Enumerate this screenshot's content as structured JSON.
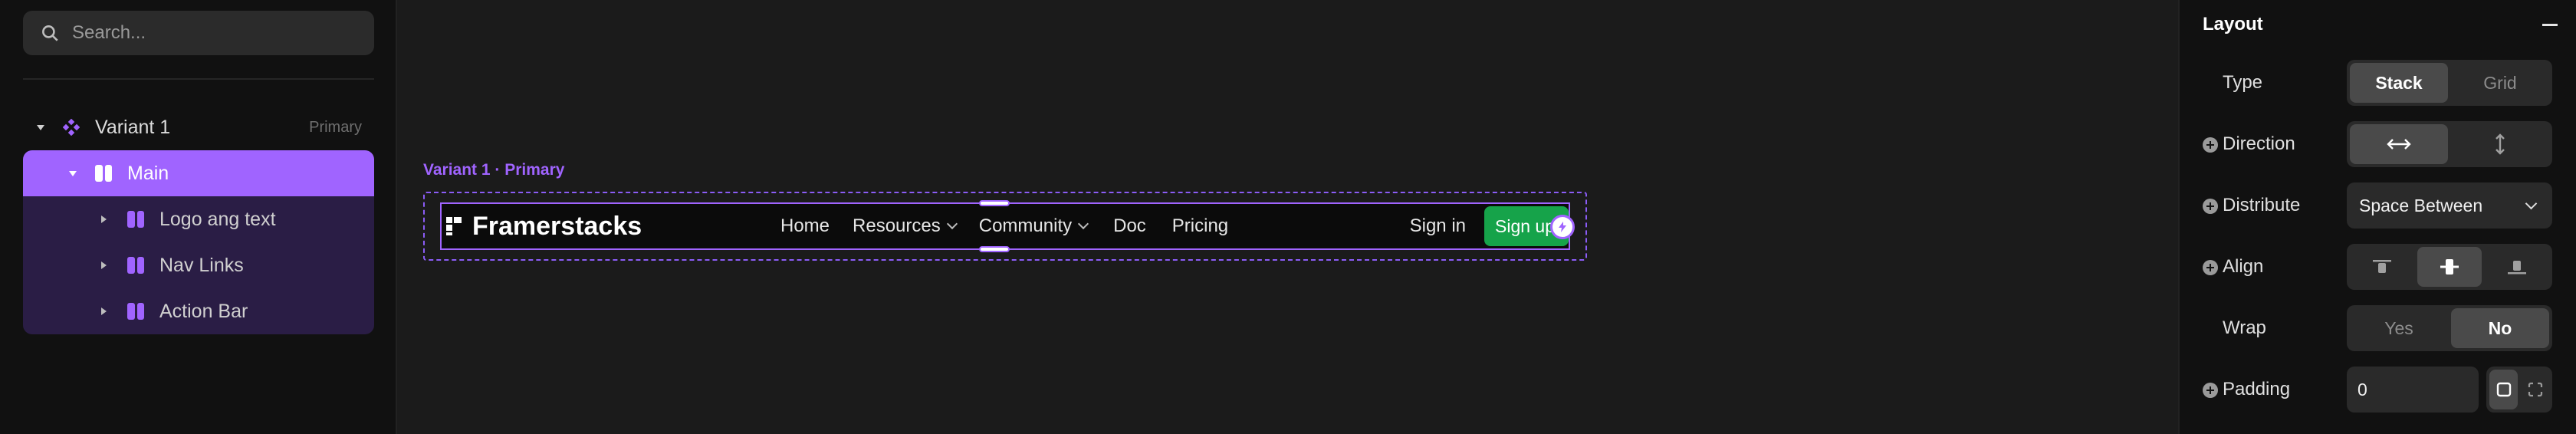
{
  "layers": {
    "search_placeholder": "Search...",
    "variant": {
      "label": "Variant 1",
      "tag": "Primary"
    },
    "main": {
      "label": "Main"
    },
    "children": [
      {
        "label": "Logo ang text"
      },
      {
        "label": "Nav Links"
      },
      {
        "label": "Action Bar"
      }
    ]
  },
  "canvas": {
    "frame_label": "Variant 1 · Primary",
    "navbar": {
      "brand": "Framerstacks",
      "links": [
        "Home",
        "Resources",
        "Community",
        "Doc",
        "Pricing"
      ],
      "signin": "Sign in",
      "signup": "Sign up"
    }
  },
  "properties": {
    "title": "Layout",
    "type": {
      "label": "Type",
      "options": [
        "Stack",
        "Grid"
      ],
      "selected": "Stack"
    },
    "direction": {
      "label": "Direction",
      "selected": "horizontal"
    },
    "distribute": {
      "label": "Distribute",
      "value": "Space Between"
    },
    "align": {
      "label": "Align",
      "selected": "center"
    },
    "wrap": {
      "label": "Wrap",
      "options": [
        "Yes",
        "No"
      ],
      "selected": "No"
    },
    "padding": {
      "label": "Padding",
      "value": "0"
    }
  },
  "colors": {
    "accent": "#a064ff",
    "signup_green": "#16a34a"
  }
}
